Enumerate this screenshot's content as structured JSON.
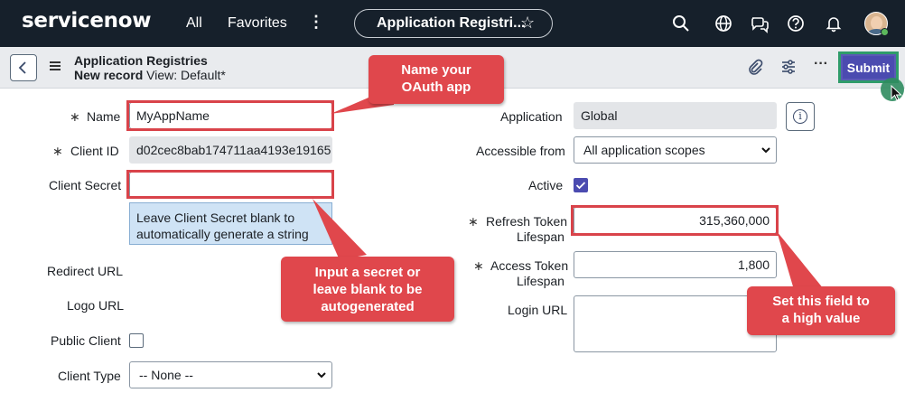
{
  "nav": {
    "logo": "servicenow",
    "all": "All",
    "favorites": "Favorites",
    "more": "⋮",
    "page_title": "Application Registri...",
    "star": "☆"
  },
  "record": {
    "title": "Application Registries",
    "sub_prefix": "New record",
    "view": "View: Default*",
    "more": "···",
    "submit": "Submit"
  },
  "form": {
    "req_mark": "∗",
    "name_label": "Name",
    "name_value": "MyAppName",
    "client_id_label": "Client ID",
    "client_id_value": "d02cec8bab174711aa4193e19165",
    "client_secret_label": "Client Secret",
    "client_secret_value": "",
    "client_secret_hint": "Leave Client Secret blank to automatically generate a string",
    "redirect_url_label": "Redirect URL",
    "logo_url_label": "Logo URL",
    "public_client_label": "Public Client",
    "client_type_label": "Client Type",
    "client_type_value": "-- None --",
    "application_label": "Application",
    "application_value": "Global",
    "accessible_from_label": "Accessible from",
    "accessible_from_value": "All application scopes",
    "active_label": "Active",
    "refresh_label_1": "Refresh Token",
    "refresh_label_2": "Lifespan",
    "refresh_value": "315,360,000",
    "access_label_1": "Access Token",
    "access_label_2": "Lifespan",
    "access_value": "1,800",
    "login_url_label": "Login URL"
  },
  "callouts": {
    "name_1": "Name your",
    "name_2": "OAuth app",
    "secret_1": "Input a secret or",
    "secret_2": "leave blank to be",
    "secret_3": "autogenerated",
    "field_1": "Set this field to",
    "field_2": "a high value"
  },
  "colors": {
    "nav_bg": "#16202b",
    "accent": "#4b4bb0",
    "callout": "#e0474c",
    "highlight": "#d9434a",
    "submit_border": "#2f9c6a",
    "hint_bg": "#cfe3f5"
  }
}
